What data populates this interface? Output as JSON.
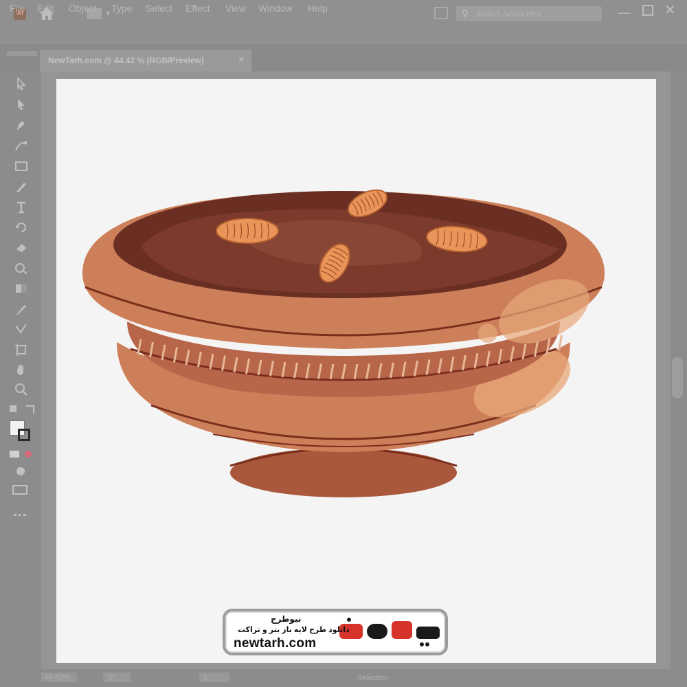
{
  "titlebar": {
    "app_icon": "illustrator-logo",
    "app_icon_text": "Ai",
    "home": "home-icon",
    "search_placeholder": "Search Adobe Help"
  },
  "menu": [
    "File",
    "Edit",
    "Object",
    "Type",
    "Select",
    "Effect",
    "View",
    "Window",
    "Help"
  ],
  "document_tab": {
    "label": "NewTarh.com @ 44.42 % (RGB/Preview)",
    "close": "×"
  },
  "tools": [
    "selection-tool-icon",
    "direct-selection-tool-icon",
    "pen-tool-icon",
    "curvature-tool-icon",
    "rectangle-tool-icon",
    "paintbrush-tool-icon",
    "type-tool-icon",
    "rotate-tool-icon",
    "eraser-tool-icon",
    "shape-builder-tool-icon",
    "gradient-tool-icon",
    "eyedropper-tool-icon",
    "blend-tool-icon",
    "artboard-tool-icon",
    "hand-tool-icon",
    "zoom-tool-icon"
  ],
  "status": {
    "zoom": "44.42%",
    "angle": "0°",
    "artboard": "1",
    "tool": "Selection"
  },
  "colors": {
    "bowl_body": "#cd7f5a",
    "bowl_dark": "#a9583c",
    "bowl_rim": "#d48a64",
    "bowl_line": "#7a2e1c",
    "pudding": "#6a2e22",
    "pudding_light": "#8c4a3a",
    "almond": "#e9955a",
    "highlight": "#e8a87a"
  },
  "watermark": {
    "title": "نیوطرح",
    "subtitle": "دانلود طرح لایه باز بنر و تراکت",
    "url": "newtarh.com",
    "logo_text": "نیوطرح"
  }
}
